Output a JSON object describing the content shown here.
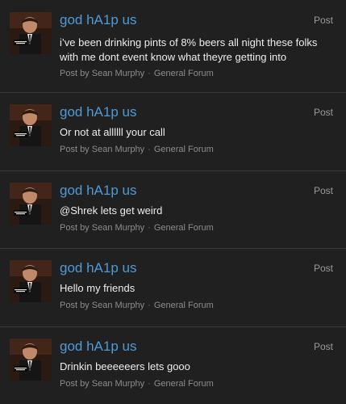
{
  "posts": [
    {
      "title": "god hA1p us",
      "action": "Post",
      "body": "i’ve been drinking pints of 8% beers all night these folks with me dont event know what theyre getting into",
      "author": "Post by Sean Murphy",
      "forum": "General Forum"
    },
    {
      "title": "god hA1p us",
      "action": "Post",
      "body": "Or not at allllll your call",
      "author": "Post by Sean Murphy",
      "forum": "General Forum"
    },
    {
      "title": "god hA1p us",
      "action": "Post",
      "body": "@Shrek lets get weird",
      "author": "Post by Sean Murphy",
      "forum": "General Forum"
    },
    {
      "title": "god hA1p us",
      "action": "Post",
      "body": "Hello my friends",
      "author": "Post by Sean Murphy",
      "forum": "General Forum"
    },
    {
      "title": "god hA1p us",
      "action": "Post",
      "body": "Drinkin beeeeeers lets gooo",
      "author": "Post by Sean Murphy",
      "forum": "General Forum"
    }
  ],
  "meta_separator": "·",
  "colors": {
    "background": "#202020",
    "title": "#4f9ad6",
    "body_text": "#ededed",
    "meta_text": "#8c8c8c",
    "divider": "#3a3a3a"
  },
  "icons": {
    "avatar": "user-avatar-photo"
  }
}
